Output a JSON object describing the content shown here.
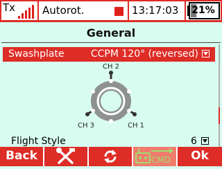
{
  "status_bar": {
    "tx_label": "Tx",
    "signal_bars": 5,
    "timer_label": "Autorot.",
    "time": "13:17:03",
    "battery_text": "21%",
    "battery_level_percent": 21
  },
  "page": {
    "title": "General"
  },
  "settings": {
    "swashplate": {
      "label": "Swashplate",
      "value": "CCPM 120° (reversed)"
    },
    "flight_style": {
      "label": "Flight Style",
      "value": "6"
    }
  },
  "diagram": {
    "ch2": "CH 2",
    "ch3": "CH 3",
    "ch1": "CH 1"
  },
  "bottom_bar": {
    "back": "Back",
    "ok": "Ok",
    "cmd": "CMD"
  },
  "colors": {
    "accent": "#de2c26",
    "background": "#d8fcf0",
    "cmd_disabled": "#f07c6e"
  }
}
